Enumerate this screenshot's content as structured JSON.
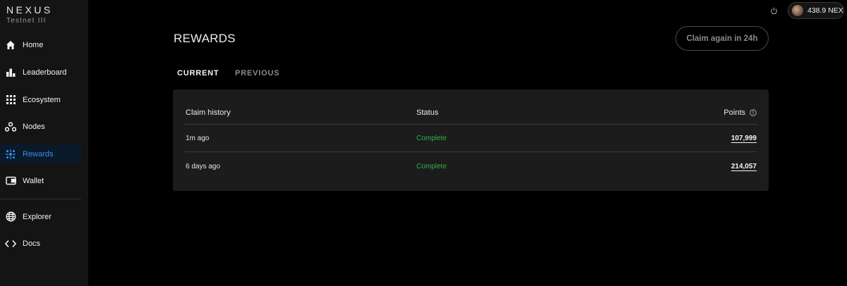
{
  "brand": {
    "name": "NEXUS",
    "subtitle": "Testnet III"
  },
  "sidebar": {
    "items": [
      {
        "label": "Home",
        "icon": "home-icon"
      },
      {
        "label": "Leaderboard",
        "icon": "bar-chart-icon"
      },
      {
        "label": "Ecosystem",
        "icon": "grid-icon"
      },
      {
        "label": "Nodes",
        "icon": "nodes-icon"
      },
      {
        "label": "Rewards",
        "icon": "rewards-icon",
        "active": true
      },
      {
        "label": "Wallet",
        "icon": "wallet-icon"
      },
      {
        "label": "Explorer",
        "icon": "globe-icon"
      },
      {
        "label": "Docs",
        "icon": "code-icon"
      }
    ]
  },
  "header": {
    "balance": "438.9 NEX"
  },
  "main": {
    "title": "REWARDS",
    "claim_button": "Claim again in 24h",
    "tabs": [
      {
        "label": "CURRENT",
        "active": true
      },
      {
        "label": "PREVIOUS",
        "active": false
      }
    ],
    "table": {
      "columns": [
        "Claim history",
        "Status",
        "Points"
      ],
      "rows": [
        {
          "time": "1m ago",
          "status": "Complete",
          "points": "107,999"
        },
        {
          "time": "6 days ago",
          "status": "Complete",
          "points": "214,057"
        }
      ]
    }
  },
  "colors": {
    "accent": "#3d8bf0",
    "success": "#2db24a",
    "background": "#000000",
    "sidebar": "#141414",
    "card": "#1c1c1c"
  }
}
